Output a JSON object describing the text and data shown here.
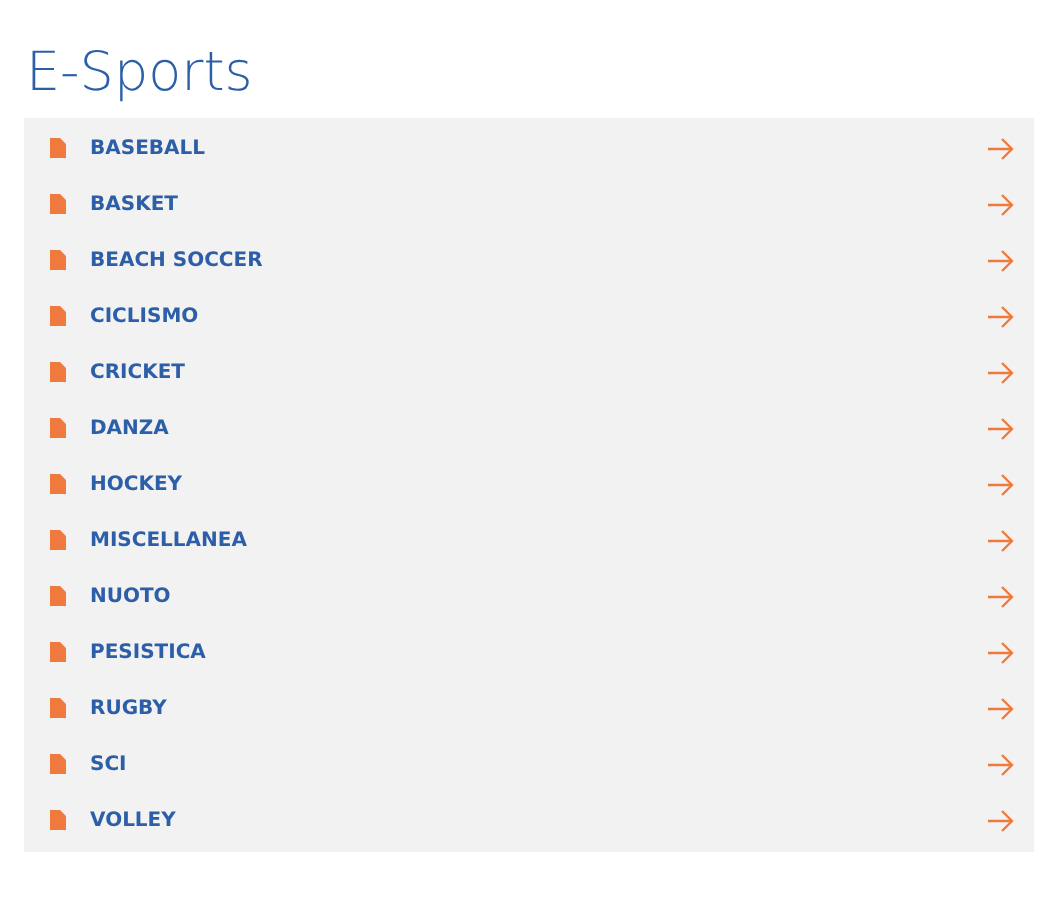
{
  "title": "E-Sports",
  "items": [
    {
      "label": "BASEBALL"
    },
    {
      "label": "BASKET"
    },
    {
      "label": "BEACH SOCCER"
    },
    {
      "label": "CICLISMO"
    },
    {
      "label": "CRICKET"
    },
    {
      "label": "DANZA"
    },
    {
      "label": "HOCKEY"
    },
    {
      "label": "MISCELLANEA"
    },
    {
      "label": "NUOTO"
    },
    {
      "label": "PESISTICA"
    },
    {
      "label": "RUGBY"
    },
    {
      "label": "SCI"
    },
    {
      "label": "VOLLEY"
    }
  ]
}
